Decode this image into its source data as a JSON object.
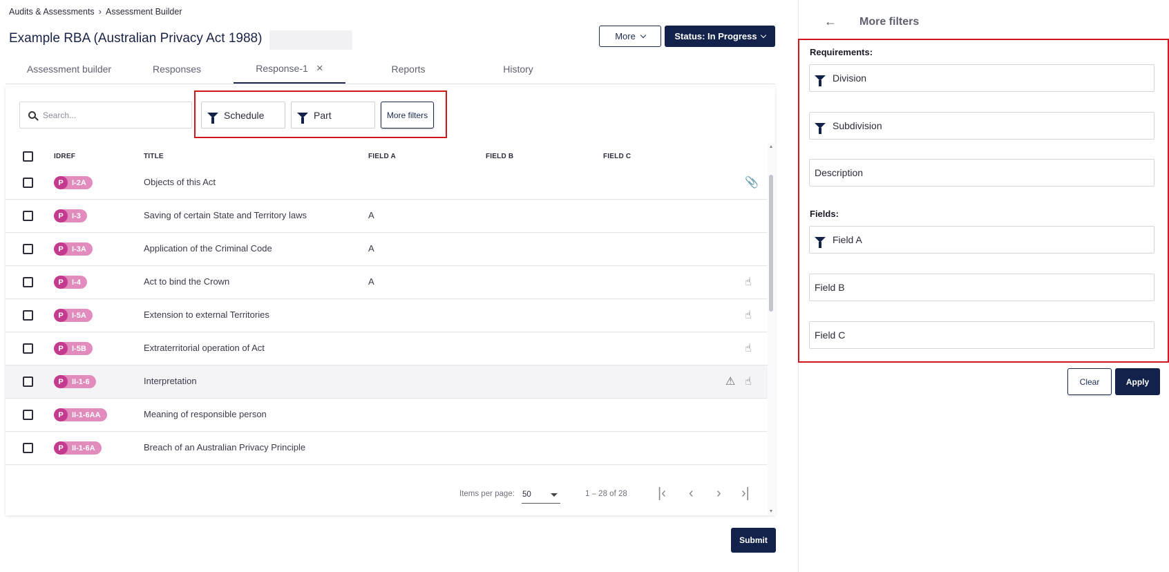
{
  "breadcrumb": {
    "parent": "Audits & Assessments",
    "current": "Assessment Builder"
  },
  "page": {
    "title": "Example RBA (Australian Privacy Act 1988)"
  },
  "header": {
    "more_label": "More",
    "status_label": "Status: In Progress"
  },
  "tabs": [
    {
      "label": "Assessment builder"
    },
    {
      "label": "Responses"
    },
    {
      "label": "Response-1",
      "close": "×",
      "active": true
    },
    {
      "label": "Reports"
    },
    {
      "label": "History"
    }
  ],
  "toolbar": {
    "search_placeholder": "Search...",
    "filters": [
      {
        "label": "Schedule"
      },
      {
        "label": "Part"
      }
    ],
    "more_filters_label": "More filters"
  },
  "table": {
    "columns": [
      "IDREF",
      "TITLE",
      "FIELD A",
      "FIELD B",
      "FIELD C"
    ],
    "rows": [
      {
        "prefix": "P",
        "id": "I-2A",
        "title": "Objects of this Act",
        "field_a": "",
        "icons": [
          "paperclip-icon"
        ]
      },
      {
        "prefix": "P",
        "id": "I-3",
        "title": "Saving of certain State and Territory laws",
        "field_a": "A",
        "icons": []
      },
      {
        "prefix": "P",
        "id": "I-3A",
        "title": "Application of the Criminal Code",
        "field_a": "A",
        "icons": []
      },
      {
        "prefix": "P",
        "id": "I-4",
        "title": "Act to bind the Crown",
        "field_a": "A",
        "icons": [
          "hand-touch-icon"
        ]
      },
      {
        "prefix": "P",
        "id": "I-5A",
        "title": "Extension to external Territories",
        "field_a": "",
        "icons": [
          "hand-touch-icon"
        ]
      },
      {
        "prefix": "P",
        "id": "I-5B",
        "title": "Extraterritorial operation of Act",
        "field_a": "",
        "icons": [
          "hand-touch-icon"
        ]
      },
      {
        "prefix": "P",
        "id": "II-1-6",
        "title": "Interpretation",
        "field_a": "",
        "icons": [
          "warning-icon",
          "hand-touch-icon"
        ],
        "highlight": true
      },
      {
        "prefix": "P",
        "id": "II-1-6AA",
        "title": "Meaning of responsible person",
        "field_a": "",
        "icons": []
      },
      {
        "prefix": "P",
        "id": "II-1-6A",
        "title": "Breach of an Australian Privacy Principle",
        "field_a": "",
        "icons": []
      }
    ]
  },
  "pagination": {
    "items_per_page_label": "Items per page:",
    "items_per_page": "50",
    "range": "1 – 28 of 28"
  },
  "footer": {
    "submit_label": "Submit"
  },
  "panel": {
    "back": "←",
    "title": "More filters",
    "requirements_label": "Requirements:",
    "requirements": [
      {
        "label": "Division",
        "filter_icon": true
      },
      {
        "label": "Subdivision",
        "filter_icon": true
      },
      {
        "label": "Description",
        "filter_icon": false
      }
    ],
    "fields_label": "Fields:",
    "fields": [
      {
        "label": "Field A",
        "filter_icon": true
      },
      {
        "label": "Field B",
        "filter_icon": false
      },
      {
        "label": "Field C",
        "filter_icon": false
      }
    ],
    "clear_label": "Clear",
    "apply_label": "Apply"
  },
  "colors": {
    "navy": "#12224a",
    "badge": "#e28bbd",
    "badge_prefix": "#c43a8e",
    "highlight_border": "#d0161b"
  }
}
